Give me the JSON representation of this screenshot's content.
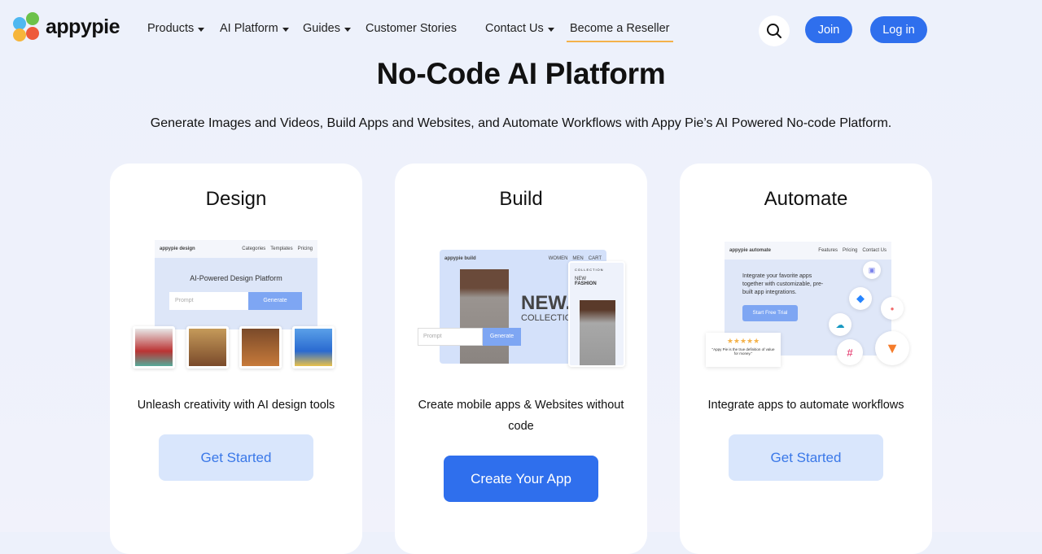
{
  "nav": {
    "logo": "appypie",
    "items": [
      {
        "label": "Products",
        "dropdown": true
      },
      {
        "label": "AI Platform",
        "dropdown": true
      },
      {
        "label": "Guides",
        "dropdown": true
      },
      {
        "label": "Customer Stories",
        "dropdown": false
      },
      {
        "label": "Contact Us",
        "dropdown": true
      },
      {
        "label": "Become a Reseller",
        "dropdown": false
      }
    ],
    "join": "Join",
    "login": "Log in",
    "search_icon": "search-icon"
  },
  "hero": {
    "title": "No-Code AI Platform",
    "subtitle": "Generate Images and Videos, Build Apps and Websites, and Automate Workflows with Appy Pie’s AI Powered No-code Platform."
  },
  "cards": [
    {
      "title": "Design",
      "desc": "Unleash creativity with AI design tools",
      "button": "Get Started",
      "shot": {
        "brand": "appypie design",
        "links": [
          "Categories",
          "Templates",
          "Pricing"
        ],
        "headline": "AI-Powered Design Platform",
        "placeholder": "Prompt",
        "cta": "Generate"
      }
    },
    {
      "title": "Build",
      "desc": "Create mobile apps & Websites without code",
      "button": "Create Your App",
      "shot": {
        "brand": "appypie build",
        "links": [
          "WOMEN",
          "MEN",
          "CART"
        ],
        "big": "NEW.",
        "small": "COLLECTION",
        "mobile_label": "COLLECTION",
        "mobile_new": "NEW",
        "mobile_fashion": "FASHION",
        "placeholder": "Prompt",
        "cta": "Generate"
      }
    },
    {
      "title": "Automate",
      "desc": "Integrate apps to automate workflows",
      "button": "Get Started",
      "shot": {
        "brand": "appypie automate",
        "links": [
          "Features",
          "Pricing",
          "Contact Us"
        ],
        "headline": "Integrate your favorite apps together with customizable, pre-built app integrations.",
        "cta": "Start Free Trial",
        "stars": "★★★★★",
        "quote": "\"Appy Pie is the true definition of value for money.\""
      }
    }
  ],
  "colors": {
    "primary": "#2f6fed",
    "light_button": "#d9e6fc",
    "accent_underline": "#f4b24a"
  }
}
